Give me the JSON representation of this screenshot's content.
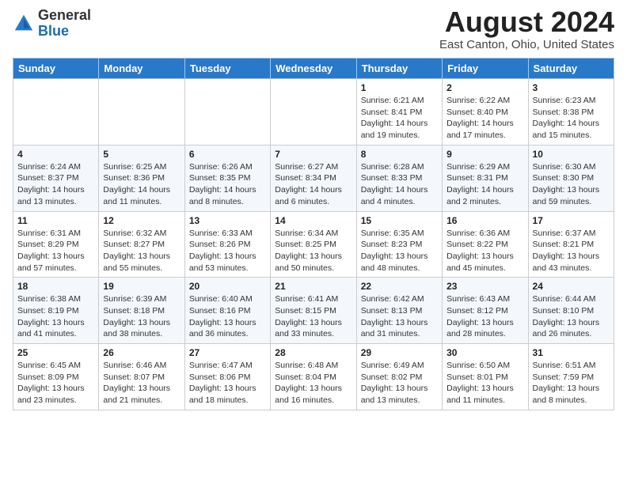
{
  "header": {
    "logo_general": "General",
    "logo_blue": "Blue",
    "month_year": "August 2024",
    "location": "East Canton, Ohio, United States"
  },
  "days_of_week": [
    "Sunday",
    "Monday",
    "Tuesday",
    "Wednesday",
    "Thursday",
    "Friday",
    "Saturday"
  ],
  "weeks": [
    [
      {
        "day": "",
        "info": ""
      },
      {
        "day": "",
        "info": ""
      },
      {
        "day": "",
        "info": ""
      },
      {
        "day": "",
        "info": ""
      },
      {
        "day": "1",
        "info": "Sunrise: 6:21 AM\nSunset: 8:41 PM\nDaylight: 14 hours and 19 minutes."
      },
      {
        "day": "2",
        "info": "Sunrise: 6:22 AM\nSunset: 8:40 PM\nDaylight: 14 hours and 17 minutes."
      },
      {
        "day": "3",
        "info": "Sunrise: 6:23 AM\nSunset: 8:38 PM\nDaylight: 14 hours and 15 minutes."
      }
    ],
    [
      {
        "day": "4",
        "info": "Sunrise: 6:24 AM\nSunset: 8:37 PM\nDaylight: 14 hours and 13 minutes."
      },
      {
        "day": "5",
        "info": "Sunrise: 6:25 AM\nSunset: 8:36 PM\nDaylight: 14 hours and 11 minutes."
      },
      {
        "day": "6",
        "info": "Sunrise: 6:26 AM\nSunset: 8:35 PM\nDaylight: 14 hours and 8 minutes."
      },
      {
        "day": "7",
        "info": "Sunrise: 6:27 AM\nSunset: 8:34 PM\nDaylight: 14 hours and 6 minutes."
      },
      {
        "day": "8",
        "info": "Sunrise: 6:28 AM\nSunset: 8:33 PM\nDaylight: 14 hours and 4 minutes."
      },
      {
        "day": "9",
        "info": "Sunrise: 6:29 AM\nSunset: 8:31 PM\nDaylight: 14 hours and 2 minutes."
      },
      {
        "day": "10",
        "info": "Sunrise: 6:30 AM\nSunset: 8:30 PM\nDaylight: 13 hours and 59 minutes."
      }
    ],
    [
      {
        "day": "11",
        "info": "Sunrise: 6:31 AM\nSunset: 8:29 PM\nDaylight: 13 hours and 57 minutes."
      },
      {
        "day": "12",
        "info": "Sunrise: 6:32 AM\nSunset: 8:27 PM\nDaylight: 13 hours and 55 minutes."
      },
      {
        "day": "13",
        "info": "Sunrise: 6:33 AM\nSunset: 8:26 PM\nDaylight: 13 hours and 53 minutes."
      },
      {
        "day": "14",
        "info": "Sunrise: 6:34 AM\nSunset: 8:25 PM\nDaylight: 13 hours and 50 minutes."
      },
      {
        "day": "15",
        "info": "Sunrise: 6:35 AM\nSunset: 8:23 PM\nDaylight: 13 hours and 48 minutes."
      },
      {
        "day": "16",
        "info": "Sunrise: 6:36 AM\nSunset: 8:22 PM\nDaylight: 13 hours and 45 minutes."
      },
      {
        "day": "17",
        "info": "Sunrise: 6:37 AM\nSunset: 8:21 PM\nDaylight: 13 hours and 43 minutes."
      }
    ],
    [
      {
        "day": "18",
        "info": "Sunrise: 6:38 AM\nSunset: 8:19 PM\nDaylight: 13 hours and 41 minutes."
      },
      {
        "day": "19",
        "info": "Sunrise: 6:39 AM\nSunset: 8:18 PM\nDaylight: 13 hours and 38 minutes."
      },
      {
        "day": "20",
        "info": "Sunrise: 6:40 AM\nSunset: 8:16 PM\nDaylight: 13 hours and 36 minutes."
      },
      {
        "day": "21",
        "info": "Sunrise: 6:41 AM\nSunset: 8:15 PM\nDaylight: 13 hours and 33 minutes."
      },
      {
        "day": "22",
        "info": "Sunrise: 6:42 AM\nSunset: 8:13 PM\nDaylight: 13 hours and 31 minutes."
      },
      {
        "day": "23",
        "info": "Sunrise: 6:43 AM\nSunset: 8:12 PM\nDaylight: 13 hours and 28 minutes."
      },
      {
        "day": "24",
        "info": "Sunrise: 6:44 AM\nSunset: 8:10 PM\nDaylight: 13 hours and 26 minutes."
      }
    ],
    [
      {
        "day": "25",
        "info": "Sunrise: 6:45 AM\nSunset: 8:09 PM\nDaylight: 13 hours and 23 minutes."
      },
      {
        "day": "26",
        "info": "Sunrise: 6:46 AM\nSunset: 8:07 PM\nDaylight: 13 hours and 21 minutes."
      },
      {
        "day": "27",
        "info": "Sunrise: 6:47 AM\nSunset: 8:06 PM\nDaylight: 13 hours and 18 minutes."
      },
      {
        "day": "28",
        "info": "Sunrise: 6:48 AM\nSunset: 8:04 PM\nDaylight: 13 hours and 16 minutes."
      },
      {
        "day": "29",
        "info": "Sunrise: 6:49 AM\nSunset: 8:02 PM\nDaylight: 13 hours and 13 minutes."
      },
      {
        "day": "30",
        "info": "Sunrise: 6:50 AM\nSunset: 8:01 PM\nDaylight: 13 hours and 11 minutes."
      },
      {
        "day": "31",
        "info": "Sunrise: 6:51 AM\nSunset: 7:59 PM\nDaylight: 13 hours and 8 minutes."
      }
    ]
  ]
}
